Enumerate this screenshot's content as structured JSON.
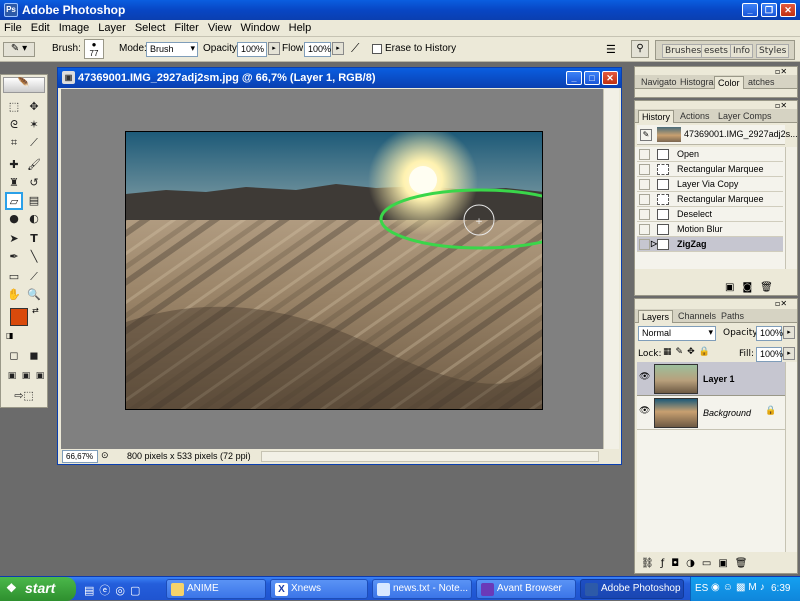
{
  "app": {
    "title": "Adobe Photoshop",
    "icon": "photoshop-icon"
  },
  "menu": [
    "File",
    "Edit",
    "Image",
    "Layer",
    "Select",
    "Filter",
    "View",
    "Window",
    "Help"
  ],
  "options": {
    "brush_label": "Brush:",
    "brush_size": "77",
    "mode_label": "Mode:",
    "mode_value": "Brush",
    "opacity_label": "Opacity:",
    "opacity_value": "100%",
    "flow_label": "Flow:",
    "flow_value": "100%",
    "erase_history_label": "Erase to History"
  },
  "palette_well": [
    "Brushes",
    "esets",
    "Info",
    "Styles"
  ],
  "document": {
    "title": "47369001.IMG_2927adj2sm.jpg @ 66,7% (Layer 1, RGB/8)",
    "zoom": "66,67%",
    "status": "800 pixels x 533 pixels (72 ppi)"
  },
  "navigator_panel": {
    "tabs": [
      "Navigato",
      "Histogra",
      "Color",
      "atches"
    ],
    "active": "Color"
  },
  "history_panel": {
    "tabs": [
      "History",
      "Actions",
      "Layer Comps"
    ],
    "snapshot": "47369001.IMG_2927adj2s...",
    "steps": [
      "Open",
      "Rectangular Marquee",
      "Layer Via Copy",
      "Rectangular Marquee",
      "Deselect",
      "Motion Blur",
      "ZigZag"
    ],
    "selected_step": "ZigZag"
  },
  "layers_panel": {
    "tabs": [
      "Layers",
      "Channels",
      "Paths"
    ],
    "blend_mode": "Normal",
    "opacity_label": "Opacity:",
    "opacity_value": "100%",
    "lock_label": "Lock:",
    "fill_label": "Fill:",
    "fill_value": "100%",
    "layers": [
      {
        "name": "Layer 1",
        "selected": true
      },
      {
        "name": "Background",
        "selected": false
      }
    ]
  },
  "taskbar": {
    "start_label": "start",
    "buttons": [
      "ANIME",
      "Xnews",
      "news.txt - Note...",
      "Avant Browser",
      "Adobe Photoshop"
    ],
    "active": "Adobe Photoshop",
    "lang": "ES",
    "clock": "6:39"
  },
  "colors": {
    "foreground": "#d94a0c",
    "background": "#f0a01e",
    "selection_ellipse": "#3ad64a"
  }
}
